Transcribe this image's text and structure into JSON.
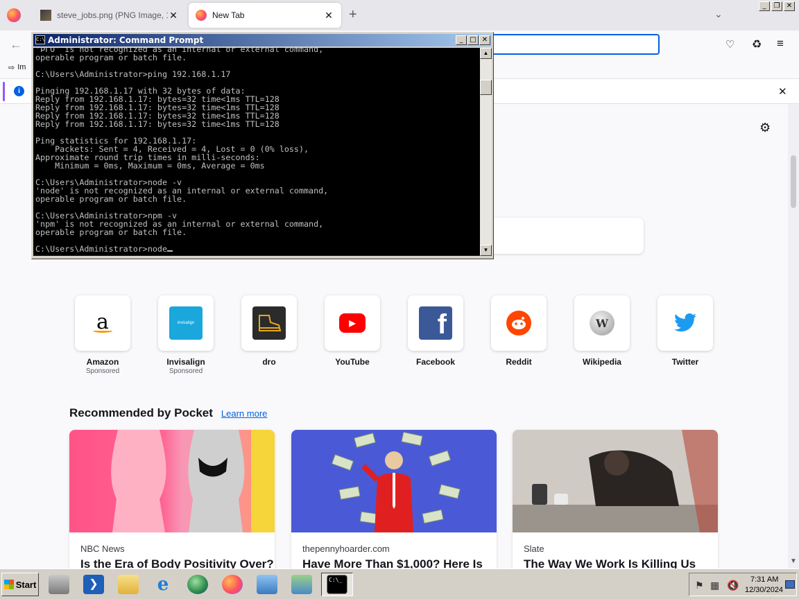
{
  "browser": {
    "tabs": [
      {
        "title": "steve_jobs.png (PNG Image, 1920",
        "active": false
      },
      {
        "title": "New Tab",
        "active": true
      }
    ],
    "new_tab_symbol": "+",
    "close_symbol": "✕",
    "bookmarks": {
      "import_label": "Im"
    },
    "icons": {
      "menu": "firefox-logo-icon",
      "back": "back-arrow-icon",
      "pocket": "pocket-icon",
      "extensions": "puzzle-icon",
      "app_menu": "hamburger-icon",
      "info": "info-icon",
      "settings": "gear-icon"
    }
  },
  "newtab": {
    "top_sites": [
      {
        "label": "Amazon",
        "sublabel": "Sponsored",
        "logo_color": "#ffffff"
      },
      {
        "label": "Invisalign",
        "sublabel": "Sponsored",
        "logo_color": "#1aa7dc"
      },
      {
        "label": "dro",
        "sublabel": "",
        "logo_color": "#2b2b2b"
      },
      {
        "label": "YouTube",
        "sublabel": "",
        "logo_color": "#ff0000"
      },
      {
        "label": "Facebook",
        "sublabel": "",
        "logo_color": "#1877f2"
      },
      {
        "label": "Reddit",
        "sublabel": "",
        "logo_color": "#ff4500"
      },
      {
        "label": "Wikipedia",
        "sublabel": "",
        "logo_color": "#ffffff"
      },
      {
        "label": "Twitter",
        "sublabel": "",
        "logo_color": "#1d9bf0"
      }
    ],
    "pocket": {
      "title": "Recommended by Pocket",
      "learn_more": "Learn more",
      "cards": [
        {
          "source": "NBC News",
          "title": "Is the Era of Body Positivity Over?"
        },
        {
          "source": "thepennyhoarder.com",
          "title": "Have More Than $1,000? Here Is"
        },
        {
          "source": "Slate",
          "title": "The Way We Work Is Killing Us"
        }
      ]
    }
  },
  "cmd": {
    "title": "Administrator: Command Prompt",
    "icon_text": "C:\\",
    "lines": [
      "'ÞΓÖ' is not recognized as an internal or external command,",
      "operable program or batch file.",
      "",
      "C:\\Users\\Administrator>ping 192.168.1.17",
      "",
      "Pinging 192.168.1.17 with 32 bytes of data:",
      "Reply from 192.168.1.17: bytes=32 time<1ms TTL=128",
      "Reply from 192.168.1.17: bytes=32 time<1ms TTL=128",
      "Reply from 192.168.1.17: bytes=32 time<1ms TTL=128",
      "Reply from 192.168.1.17: bytes=32 time<1ms TTL=128",
      "",
      "Ping statistics for 192.168.1.17:",
      "    Packets: Sent = 4, Received = 4, Lost = 0 (0% loss),",
      "Approximate round trip times in milli-seconds:",
      "    Minimum = 0ms, Maximum = 0ms, Average = 0ms",
      "",
      "C:\\Users\\Administrator>node -v",
      "'node' is not recognized as an internal or external command,",
      "operable program or batch file.",
      "",
      "C:\\Users\\Administrator>npm -v",
      "'npm' is not recognized as an internal or external command,",
      "operable program or batch file.",
      "",
      "C:\\Users\\Administrator>node"
    ]
  },
  "taskbar": {
    "start_label": "Start",
    "clock_time": "7:31 AM",
    "clock_date": "12/30/2024",
    "quicklaunch": [
      "computer-icon",
      "powershell-icon",
      "folder-icon",
      "internet-explorer-icon",
      "network-globe-icon",
      "firefox-icon",
      "control-panel-icon",
      "file-manager-icon",
      "command-prompt-icon"
    ],
    "tray": [
      "flag-icon",
      "network-icon",
      "volume-muted-icon",
      "show-desktop-icon"
    ]
  }
}
